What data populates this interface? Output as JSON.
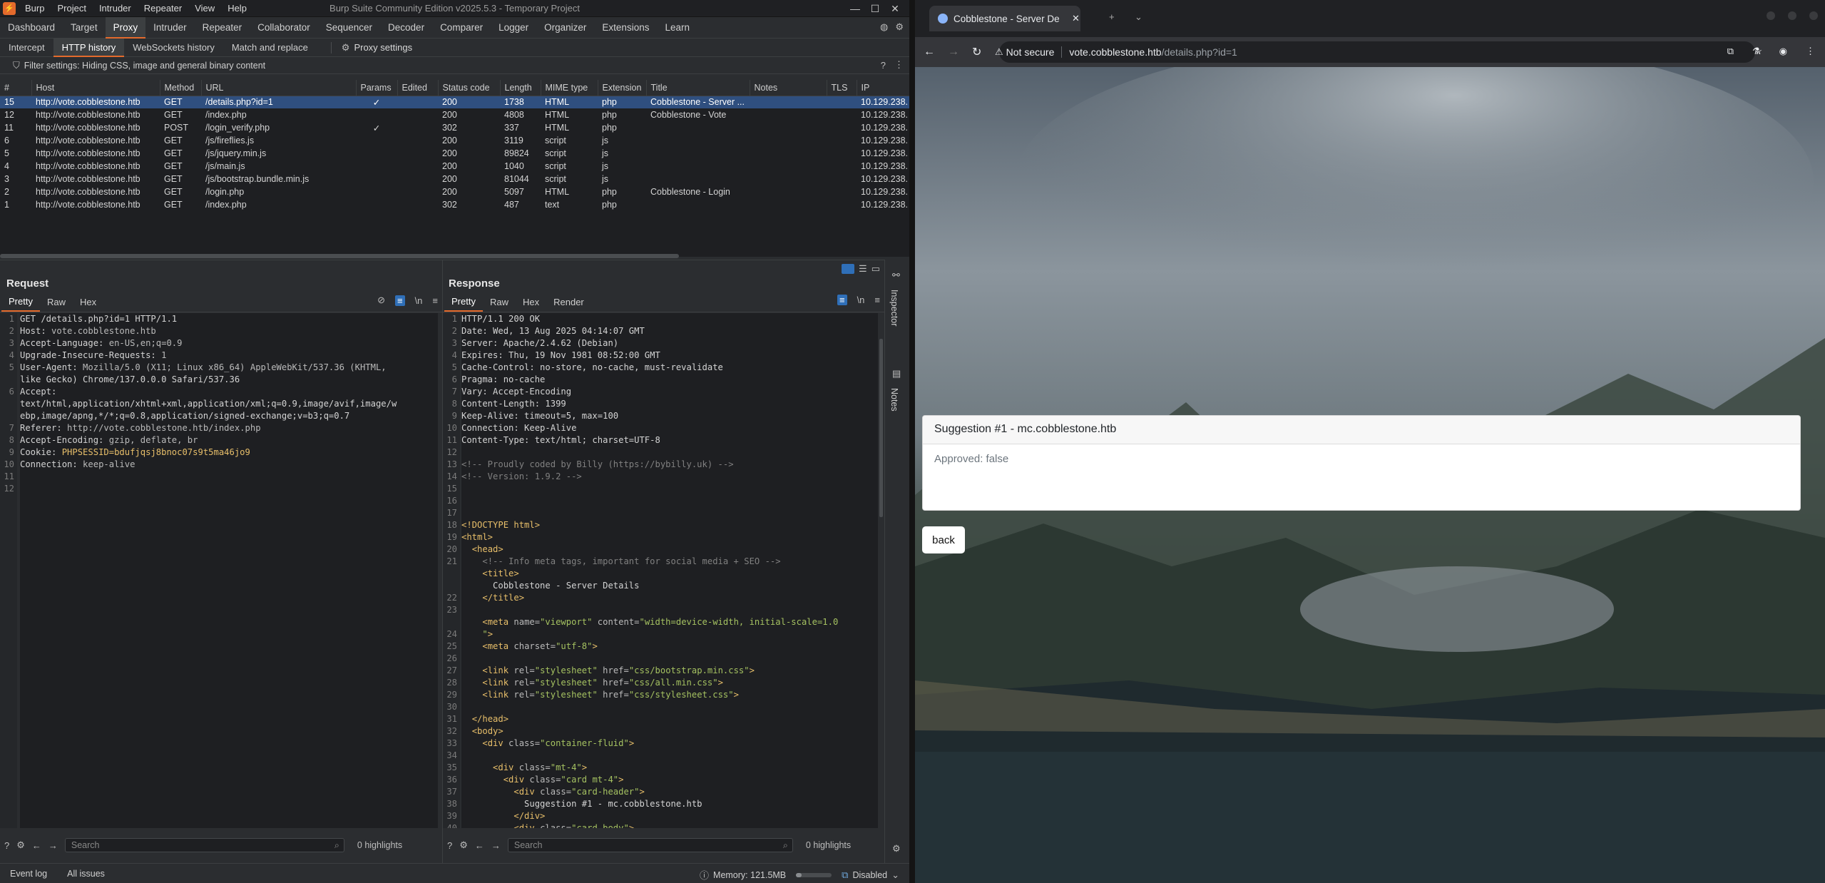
{
  "burp": {
    "window_title": "Burp Suite Community Edition v2025.5.3 - Temporary Project",
    "menu": [
      "Burp",
      "Project",
      "Intruder",
      "Repeater",
      "View",
      "Help"
    ],
    "main_tabs": [
      "Dashboard",
      "Target",
      "Proxy",
      "Intruder",
      "Repeater",
      "Collaborator",
      "Sequencer",
      "Decoder",
      "Comparer",
      "Logger",
      "Organizer",
      "Extensions",
      "Learn"
    ],
    "active_main_tab": "Proxy",
    "proxy_tabs": [
      "Intercept",
      "HTTP history",
      "WebSockets history",
      "Match and replace"
    ],
    "active_proxy_tab": "HTTP history",
    "proxy_settings_label": "Proxy settings",
    "filter_text": "Filter settings: Hiding CSS, image and general binary content",
    "history_columns": [
      "#",
      "Host",
      "Method",
      "URL",
      "Params",
      "Edited",
      "Status code",
      "Length",
      "MIME type",
      "Extension",
      "Title",
      "Notes",
      "TLS",
      "IP"
    ],
    "history_rows": [
      {
        "num": "15",
        "host": "http://vote.cobblestone.htb",
        "method": "GET",
        "url": "/details.php?id=1",
        "params": "✓",
        "edited": "",
        "status": "200",
        "length": "1738",
        "mime": "HTML",
        "ext": "php",
        "title": "Cobblestone - Server ...",
        "notes": "",
        "tls": "",
        "ip": "10.129.238."
      },
      {
        "num": "12",
        "host": "http://vote.cobblestone.htb",
        "method": "GET",
        "url": "/index.php",
        "params": "",
        "edited": "",
        "status": "200",
        "length": "4808",
        "mime": "HTML",
        "ext": "php",
        "title": "Cobblestone - Vote",
        "notes": "",
        "tls": "",
        "ip": "10.129.238."
      },
      {
        "num": "11",
        "host": "http://vote.cobblestone.htb",
        "method": "POST",
        "url": "/login_verify.php",
        "params": "✓",
        "edited": "",
        "status": "302",
        "length": "337",
        "mime": "HTML",
        "ext": "php",
        "title": "",
        "notes": "",
        "tls": "",
        "ip": "10.129.238."
      },
      {
        "num": "6",
        "host": "http://vote.cobblestone.htb",
        "method": "GET",
        "url": "/js/fireflies.js",
        "params": "",
        "edited": "",
        "status": "200",
        "length": "3119",
        "mime": "script",
        "ext": "js",
        "title": "",
        "notes": "",
        "tls": "",
        "ip": "10.129.238."
      },
      {
        "num": "5",
        "host": "http://vote.cobblestone.htb",
        "method": "GET",
        "url": "/js/jquery.min.js",
        "params": "",
        "edited": "",
        "status": "200",
        "length": "89824",
        "mime": "script",
        "ext": "js",
        "title": "",
        "notes": "",
        "tls": "",
        "ip": "10.129.238."
      },
      {
        "num": "4",
        "host": "http://vote.cobblestone.htb",
        "method": "GET",
        "url": "/js/main.js",
        "params": "",
        "edited": "",
        "status": "200",
        "length": "1040",
        "mime": "script",
        "ext": "js",
        "title": "",
        "notes": "",
        "tls": "",
        "ip": "10.129.238."
      },
      {
        "num": "3",
        "host": "http://vote.cobblestone.htb",
        "method": "GET",
        "url": "/js/bootstrap.bundle.min.js",
        "params": "",
        "edited": "",
        "status": "200",
        "length": "81044",
        "mime": "script",
        "ext": "js",
        "title": "",
        "notes": "",
        "tls": "",
        "ip": "10.129.238."
      },
      {
        "num": "2",
        "host": "http://vote.cobblestone.htb",
        "method": "GET",
        "url": "/login.php",
        "params": "",
        "edited": "",
        "status": "200",
        "length": "5097",
        "mime": "HTML",
        "ext": "php",
        "title": "Cobblestone - Login",
        "notes": "",
        "tls": "",
        "ip": "10.129.238."
      },
      {
        "num": "1",
        "host": "http://vote.cobblestone.htb",
        "method": "GET",
        "url": "/index.php",
        "params": "",
        "edited": "",
        "status": "302",
        "length": "487",
        "mime": "text",
        "ext": "php",
        "title": "",
        "notes": "",
        "tls": "",
        "ip": "10.129.238."
      }
    ],
    "request": {
      "heading": "Request",
      "tabs": [
        "Pretty",
        "Raw",
        "Hex"
      ],
      "lines": [
        "GET /details.php?id=1 HTTP/1.1",
        "Host: vote.cobblestone.htb",
        "Accept-Language: en-US,en;q=0.9",
        "Upgrade-Insecure-Requests: 1",
        "User-Agent: Mozilla/5.0 (X11; Linux x86_64) AppleWebKit/537.36 (KHTML,",
        "like Gecko) Chrome/137.0.0.0 Safari/537.36",
        "Accept:",
        "text/html,application/xhtml+xml,application/xml;q=0.9,image/avif,image/w",
        "ebp,image/apng,*/*;q=0.8,application/signed-exchange;v=b3;q=0.7",
        "Referer: http://vote.cobblestone.htb/index.php",
        "Accept-Encoding: gzip, deflate, br",
        "Cookie: PHPSESSID=bdufjqsj8bnoc07s9t5ma46jo9",
        "Connection: keep-alive",
        "",
        ""
      ],
      "gutter": "1\n2\n3\n4\n5\n\n6\n\n\n7\n8\n9\n10\n11\n12"
    },
    "response": {
      "heading": "Response",
      "tabs": [
        "Pretty",
        "Raw",
        "Hex",
        "Render"
      ],
      "gutter": "1\n2\n3\n4\n5\n6\n7\n8\n9\n10\n11\n12\n13\n14\n15\n16\n17\n18\n19\n20\n21\n\n\n22\n23\n\n24\n25\n26\n27\n28\n29\n30\n31\n32\n33\n34\n35\n36\n37\n38\n39\n40"
    },
    "search_placeholder": "Search",
    "highlights": "0 highlights",
    "side_labels": [
      "Inspector",
      "Notes"
    ],
    "status": {
      "event_log": "Event log",
      "all_issues": "All issues",
      "memory": "Memory: 121.5MB",
      "disabled": "Disabled"
    }
  },
  "browser": {
    "tab_title": "Cobblestone - Server De",
    "not_secure": "Not secure",
    "url_host": "vote.cobblestone.htb",
    "url_path": "/details.php?id=1",
    "card_header": "Suggestion #1 - mc.cobblestone.htb",
    "card_body": "Approved: false",
    "back_button": "back"
  }
}
